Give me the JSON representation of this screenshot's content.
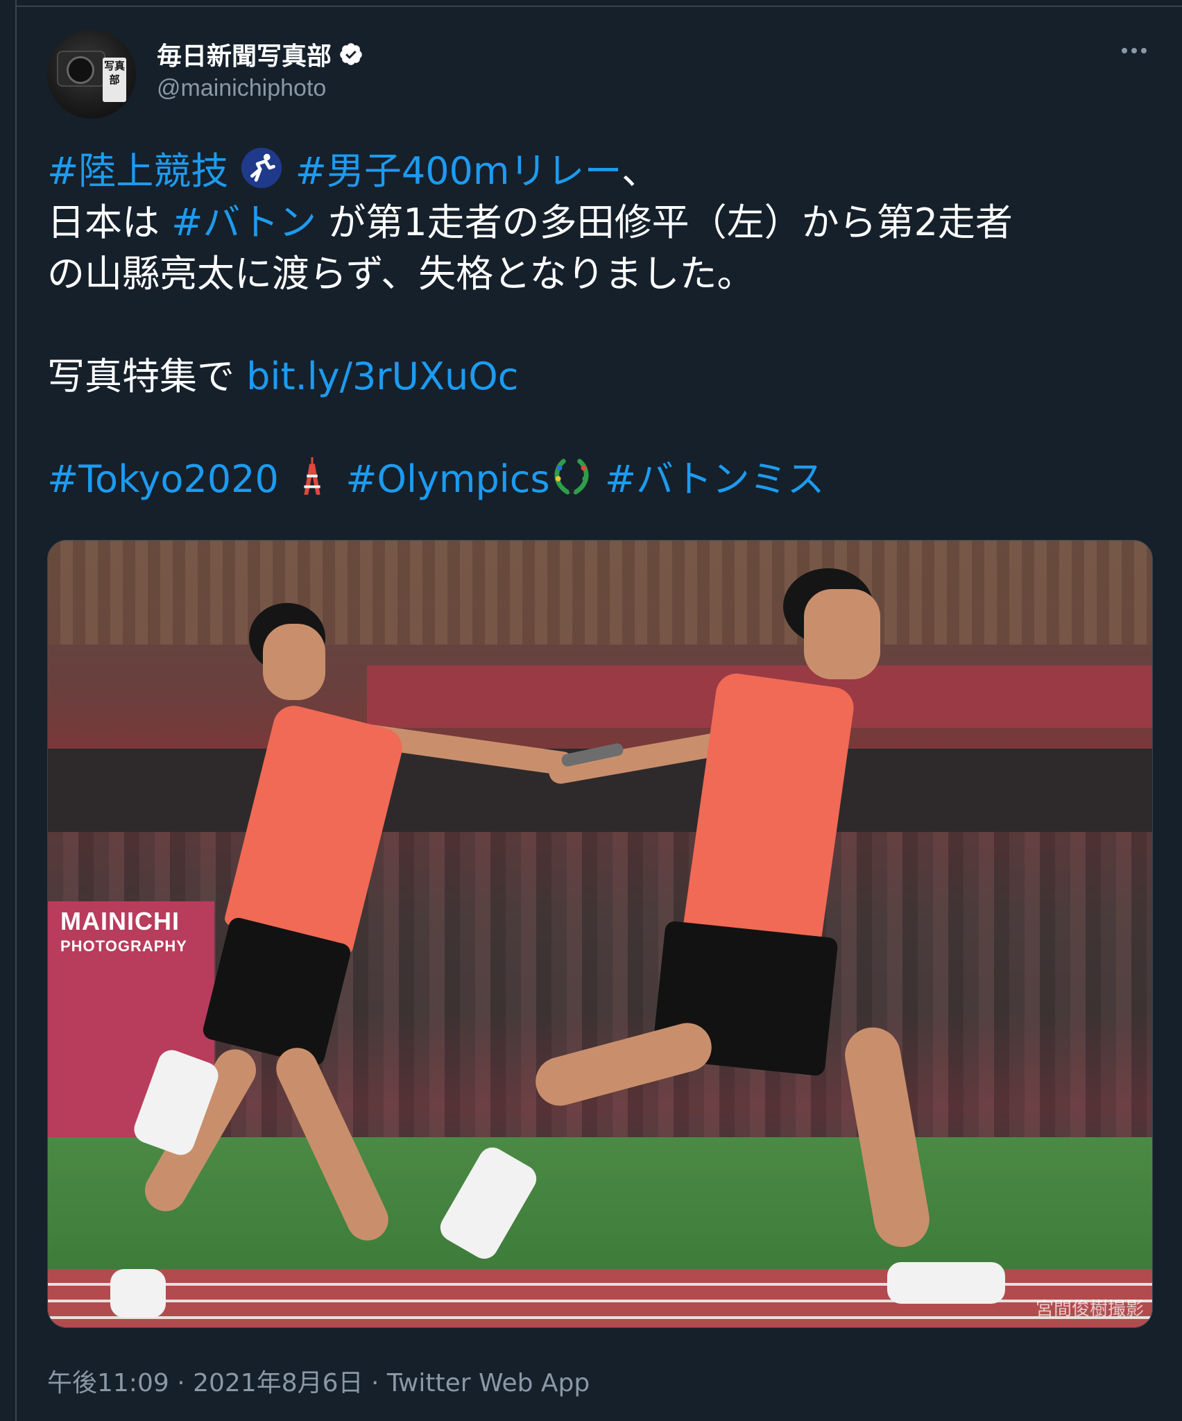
{
  "author": {
    "display_name": "毎日新聞写真部",
    "handle": "@mainichiphoto",
    "avatar_seal_text": "写真部"
  },
  "tweet": {
    "line1": {
      "tag1": "#陸上競技",
      "tag2": "#男子400mリレー",
      "punct": "、"
    },
    "line2": {
      "pre": "日本は ",
      "tag": "#バトン",
      "post": " が第1走者の多田修平（左）から第2走者"
    },
    "line3": "の山縣亮太に渡らず、失格となりました。",
    "line4": {
      "pre": "写真特集で ",
      "link": "bit.ly/3rUXuOc"
    },
    "line5": {
      "tag1": "#Tokyo2020",
      "tag2": "#Olympics",
      "tag3": "#バトンミス"
    }
  },
  "photo": {
    "watermark_line1": "MAINICHI",
    "watermark_line2": "PHOTOGRAPHY",
    "credit": "宮間俊樹撮影"
  },
  "meta": {
    "time": "午後11:09",
    "date": "2021年8月6日",
    "source": "Twitter Web App",
    "separator": " · "
  },
  "icons": {
    "verified": "verified-badge-icon",
    "more": "more-options-icon",
    "athletics_emoji": "running-sport-emoji",
    "tower_emoji": "tokyo-tower-emoji",
    "olympics_emoji": "laurel-wreath-emoji"
  },
  "colors": {
    "background": "#15202b",
    "link": "#1d9bf0",
    "secondary_text": "#8b98a5",
    "primary_text": "#ffffff"
  }
}
